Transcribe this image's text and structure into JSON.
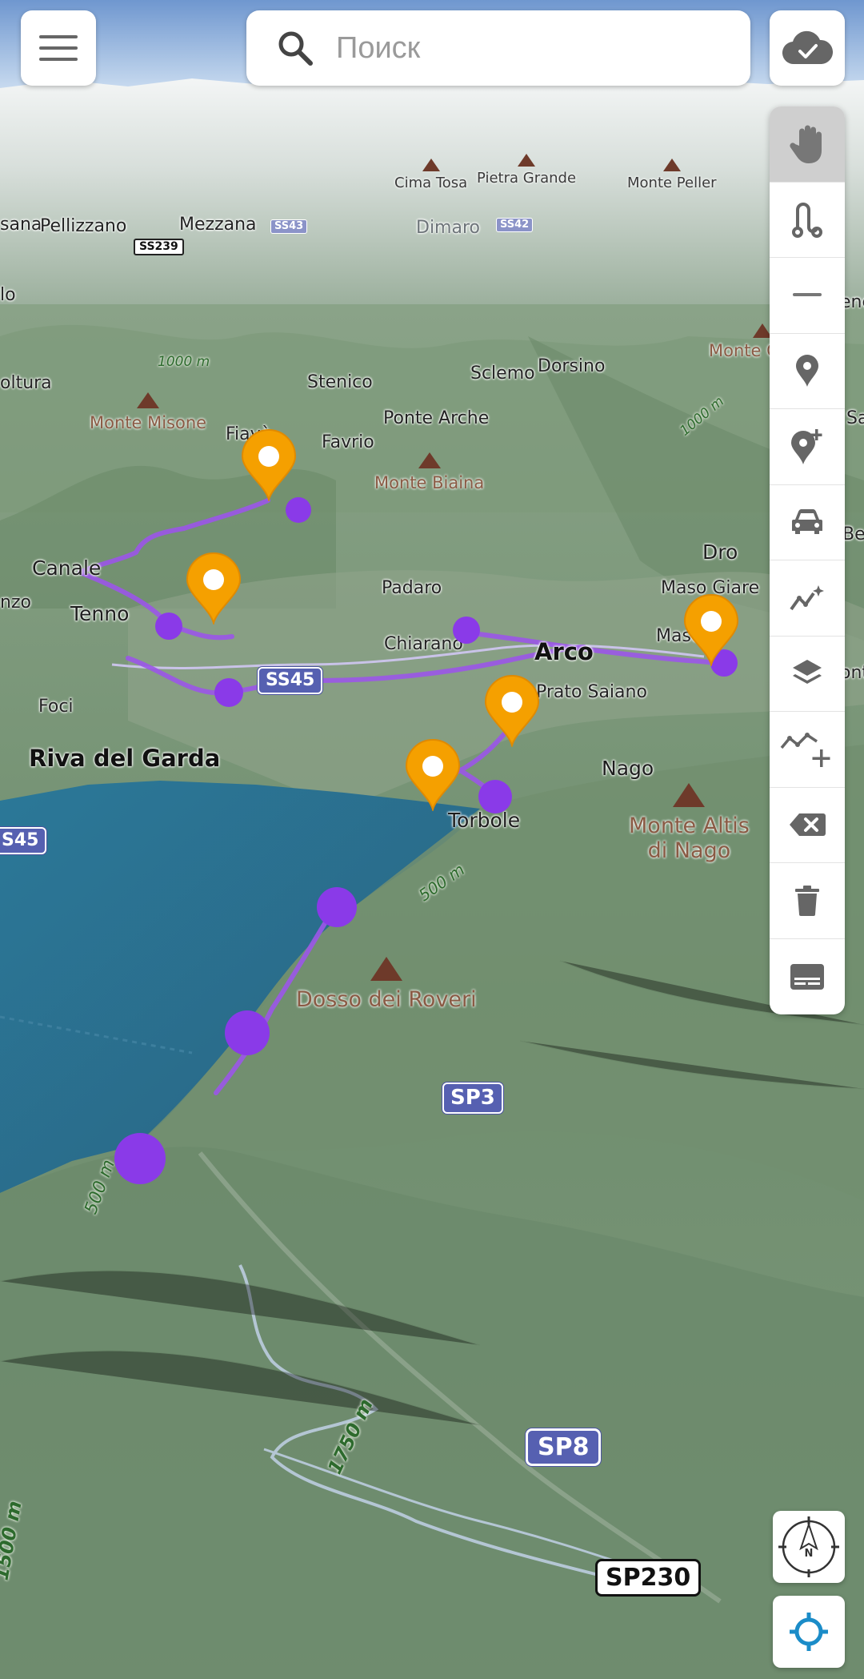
{
  "search": {
    "placeholder": "Поиск"
  },
  "top_bar": {
    "menu_icon": "hamburger-menu-icon",
    "cloud_icon": "cloud-check-icon",
    "search_icon": "search-icon"
  },
  "toolbar": {
    "tools": [
      {
        "icon": "hand-pan-icon",
        "active": true
      },
      {
        "icon": "route-icon"
      },
      {
        "icon": "minus-icon"
      },
      {
        "icon": "map-pin-icon"
      },
      {
        "icon": "add-pin-icon"
      },
      {
        "icon": "car-icon"
      },
      {
        "icon": "magic-route-icon"
      },
      {
        "icon": "layers-icon"
      },
      {
        "icon": "add-segment-icon"
      },
      {
        "icon": "backspace-icon"
      },
      {
        "icon": "trash-icon"
      },
      {
        "icon": "profile-card-icon"
      }
    ]
  },
  "bottom_controls": {
    "compass_icon": "compass-icon",
    "compass_letter": "N",
    "locate_icon": "locate-icon"
  },
  "map": {
    "peaks": {
      "cima_tosa": "Cima Tosa",
      "pietra_grande": "Pietra Grande",
      "monte_peller": "Monte Peller",
      "monte_c": "Monte C",
      "monte_misone": "Monte Misone",
      "monte_biaina": "Monte Biaina",
      "monte_altis_1": "Monte Altis",
      "monte_altis_2": "di Nago",
      "dosso_dei_roveri": "Dosso dei Roveri"
    },
    "places": {
      "sana": "sana",
      "pellizzano": "Pellizzano",
      "mezzana": "Mezzana",
      "dimaro": "Dimaro",
      "lo": "lo",
      "oltura": "oltura",
      "stenico": "Stenico",
      "sclemo": "Sclemo",
      "dorsino": "Dorsino",
      "ponte_arche": "Ponte Arche",
      "fiave": "Fiavè",
      "favrio": "Favrio",
      "canale": "Canale",
      "nzo": "nzo",
      "tenno": "Tenno",
      "padaro": "Padaro",
      "chiarano": "Chiarano",
      "arco": "Arco",
      "dro": "Dro",
      "maso_giare": "Maso Giare",
      "masone": "Masone",
      "prato_saiano": "Prato Saiano",
      "foci": "Foci",
      "riva_del_garda": "Riva del Garda",
      "nago": "Nago",
      "torbole": "Torbole",
      "ene": "ene",
      "sa": "Sa",
      "be": "Be",
      "ont": "ont"
    },
    "roads": {
      "ss239": "SS239",
      "ss43": "SS43",
      "ss42": "SS42",
      "ss45_a": "SS45",
      "ss45_b": "S45",
      "sp3": "SP3",
      "sp8": "SP8",
      "sp230": "SP230"
    },
    "contours": {
      "c1000a": "1000 m",
      "c1000b": "1000 m",
      "c500": "500 m",
      "c500b": "500 m",
      "c1750": "1750 m",
      "c1500": "1500 m"
    },
    "colors": {
      "route": "#8a3ae8",
      "pin": "#f5a000",
      "lake": "#2f7390"
    }
  }
}
